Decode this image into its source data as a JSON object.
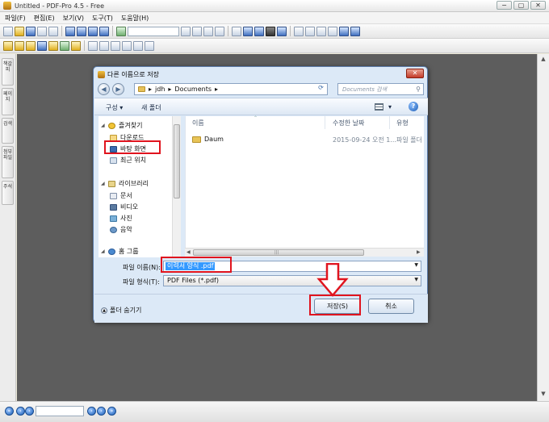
{
  "app": {
    "title": "Untitled - PDF-Pro 4.5 - Free",
    "window_buttons": [
      "−",
      "▢",
      "✕"
    ]
  },
  "menu": [
    "파일(F)",
    "편집(E)",
    "보기(V)",
    "도구(T)",
    "도움말(H)"
  ],
  "sidebar_tabs": [
    "책갈피",
    "페이지",
    "검색",
    "첨부파일",
    "주석"
  ],
  "dialog": {
    "title": "다른 이름으로 저장",
    "address": {
      "back": "◀",
      "forward": "▶",
      "sep1": "▸",
      "seg1": "jdh",
      "sep2": "▸",
      "seg2": "Documents",
      "sep3": "▸"
    },
    "search_placeholder": "Documents 검색",
    "commands": {
      "organize": "구성 ▾",
      "new_folder": "새 폴더",
      "view_caret": "▾",
      "help": "?"
    },
    "nav": {
      "favorites": "즐겨찾기",
      "downloads": "다운로드",
      "desktop": "바탕 화면",
      "recent": "최근 위치",
      "libraries": "라이브러리",
      "documents": "문서",
      "videos": "비디오",
      "pictures": "사진",
      "music": "음악",
      "homegroup": "홈 그룹"
    },
    "columns": {
      "name": "이름",
      "modified": "수정한 날짜",
      "type": "유형"
    },
    "files": [
      {
        "name": "Daum",
        "modified": "2015-09-24 오전 1...",
        "type": "파일 폴더"
      }
    ],
    "file_name_label": "파일 이름(N):",
    "file_name_value": "이력서 양식 .pdf",
    "file_type_label": "파일 형식(T):",
    "file_type_value": "PDF Files (*.pdf)",
    "hide_folders": "폴더 숨기기",
    "save_button": "저장(S)",
    "cancel_button": "취소"
  },
  "colors": {
    "highlight": "#e0141e",
    "workspace": "#5d5d5d",
    "selection": "#3399ff"
  }
}
